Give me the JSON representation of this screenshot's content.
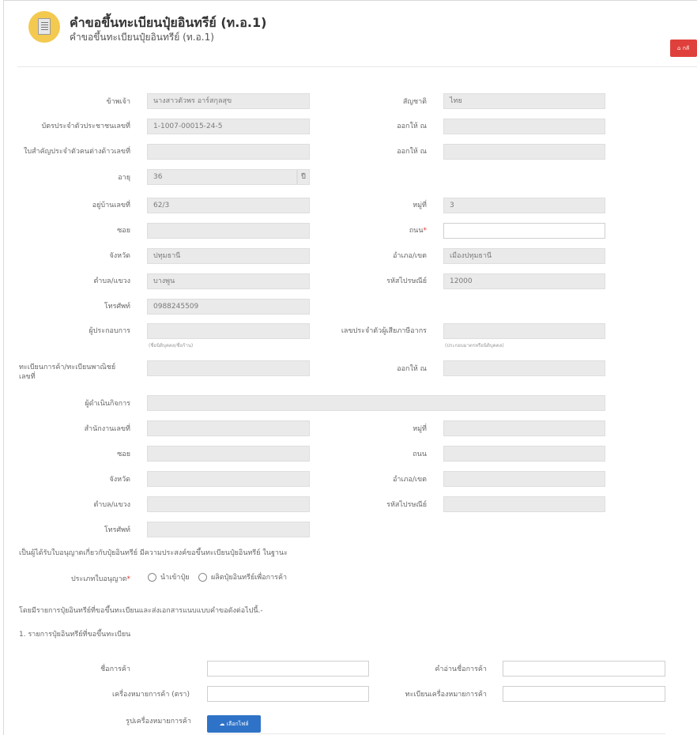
{
  "header": {
    "title": "คำขอขึ้นทะเบียนปุ๋ยอินทรีย์ (ท.อ.1)",
    "subtitle": "คำขอขึ้นทะเบียนปุ๋ยอินทรีย์ (ท.อ.1)",
    "back_label": "กลั"
  },
  "applicant": {
    "name_label": "ข้าพเจ้า",
    "name_value": "นางสาวตัวพร อาร์สกุลสุข",
    "nationality_label": "สัญชาติ",
    "nationality_value": "ไทย",
    "id_label": "บัตรประจำตัวประชาชนเลขที่",
    "id_value": "1-1007-00015-24-5",
    "issued_by_label": "ออกให้ ณ",
    "issued_by_value": "",
    "alien_id_label": "ใบสำคัญประจำตัวคนต่างด้าวเลขที่",
    "alien_id_value": "",
    "alien_issued_by_label": "ออกให้ ณ",
    "alien_issued_by_value": "",
    "age_label": "อายุ",
    "age_value": "36",
    "age_unit": "ปี",
    "house_no_label": "อยู่บ้านเลขที่",
    "house_no_value": "62/3",
    "moo_label": "หมู่ที่",
    "moo_value": "3",
    "soi_label": "ซอย",
    "soi_value": "",
    "road_label": "ถนน",
    "road_required": "*",
    "road_value": "",
    "province_label": "จังหวัด",
    "province_value": "ปทุมธานี",
    "district_label": "อำเภอ/เขต",
    "district_value": "เมืองปทุมธานี",
    "subdistrict_label": "ตำบล/แขวง",
    "subdistrict_value": "บางพูน",
    "postcode_label": "รหัสไปรษณีย์",
    "postcode_value": "12000",
    "phone_label": "โทรศัพท์",
    "phone_value": "0988245509"
  },
  "operator": {
    "operator_label": "ผู้ประกอบการ",
    "operator_value": "",
    "operator_hint": "(ชื่อนิติบุคคล/ชื่อร้าน)",
    "tax_id_label": "เลขประจำตัวผู้เสียภาษีอากร",
    "tax_id_value": "",
    "tax_id_hint": "(ประกอบมาตรหรือนิติบุคคล)",
    "commerce_label": "ทะเบียนการค้า/ทะเบียนพาณิชย์ เลขที่",
    "commerce_value": "",
    "commerce_issued_label": "ออกให้ ณ",
    "commerce_issued_value": "",
    "manager_label": "ผู้ดำเนินกิจการ",
    "manager_value": "",
    "office_no_label": "สำนักงานเลขที่",
    "office_no_value": "",
    "office_moo_label": "หมู่ที่",
    "office_moo_value": "",
    "office_soi_label": "ซอย",
    "office_soi_value": "",
    "office_road_label": "ถนน",
    "office_road_value": "",
    "office_province_label": "จังหวัด",
    "office_province_value": "",
    "office_district_label": "อำเภอ/เขต",
    "office_district_value": "",
    "office_subdistrict_label": "ตำบล/แขวง",
    "office_subdistrict_value": "",
    "office_postcode_label": "รหัสไปรษณีย์",
    "office_postcode_value": "",
    "office_phone_label": "โทรศัพท์",
    "office_phone_value": ""
  },
  "license": {
    "intro": "เป็นผู้ได้รับใบอนุญาตเกี่ยวกับปุ๋ยอินทรีย์ มีความประสงค์ขอขึ้นทะเบียนปุ๋ยอินทรีย์ ในฐานะ",
    "type_label": "ประเภทใบอนุญาต",
    "type_required": "*",
    "option_1": "นำเข้าปุ๋ย",
    "option_2": "ผลิตปุ๋ยอินทรีย์เพื่อการค้า"
  },
  "products": {
    "intro": "โดยมีรายการปุ๋ยอินทรีย์ที่ขอขึ้นทะเบียนและส่งเอกสารแนบแบบคำขอดังต่อไปนี้.-",
    "section_title": "1. รายการปุ๋ยอินทรีย์ที่ขอขึ้นทะเบียน",
    "trade_name_label": "ชื่อการค้า",
    "trade_name_value": "",
    "trade_name_reading_label": "คำอ่านชื่อการค้า",
    "trade_name_reading_value": "",
    "trademark_label": "เครื่องหมายการค้า (ตรา)",
    "trademark_value": "",
    "trademark_reg_label": "ทะเบียนเครื่องหมายการค้า",
    "trademark_reg_value": "",
    "trademark_image_label": "รูปเครื่องหมายการค้า",
    "choose_file_label": "☁ เลือกไฟล์"
  }
}
